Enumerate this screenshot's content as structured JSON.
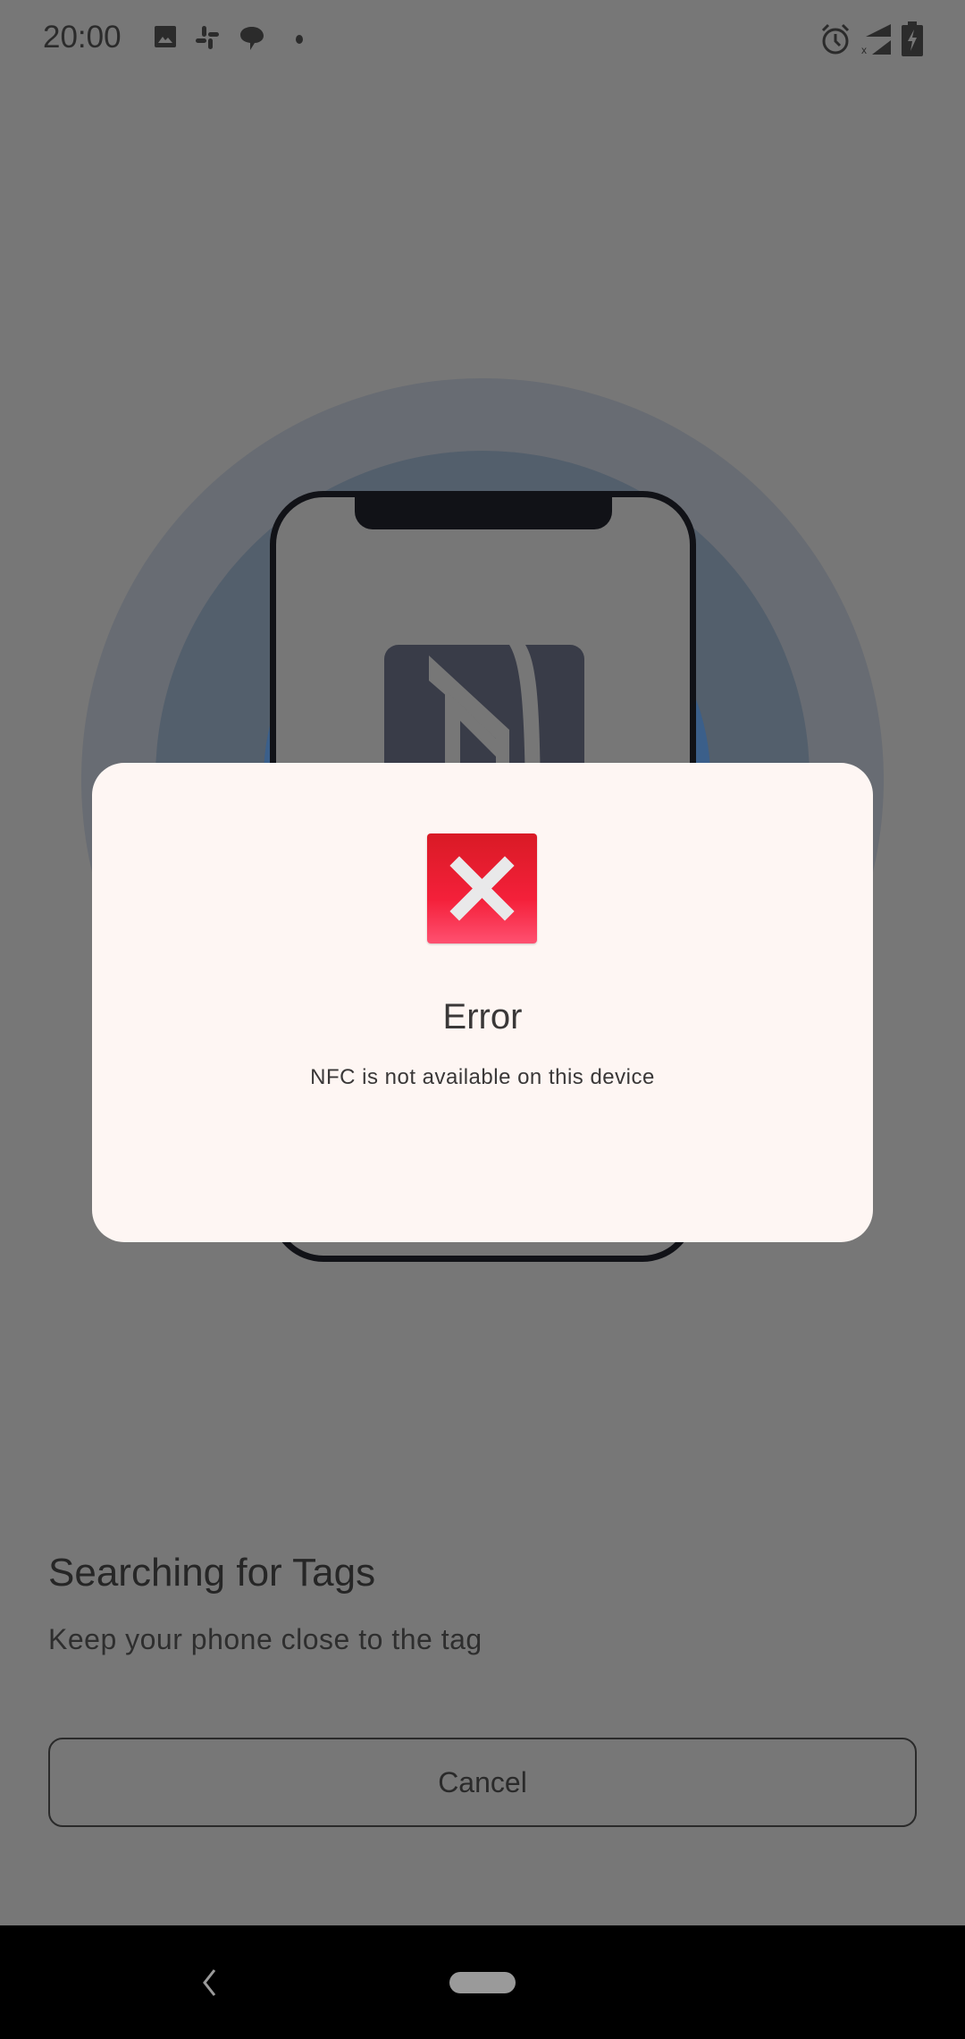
{
  "status_bar": {
    "time": "20:00",
    "left_icons": [
      "image-icon",
      "slack-icon",
      "chat-bubble-icon",
      "dot-icon"
    ],
    "right_icons": [
      "alarm-icon",
      "signal-no-data-icon",
      "battery-charging-icon"
    ]
  },
  "screen": {
    "title": "Searching for Tags",
    "subtitle": "Keep your phone close to the tag",
    "cancel_label": "Cancel"
  },
  "dialog": {
    "title": "Error",
    "message": "NFC is not available on this device",
    "icon": "error-x-icon",
    "accent": "#ee1f33"
  },
  "nav_bar": {
    "back_icon": "back-chevron-icon",
    "home_icon": "home-pill-icon"
  }
}
